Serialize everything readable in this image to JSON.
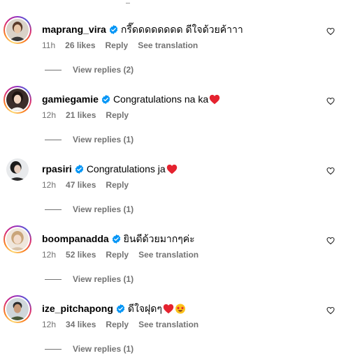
{
  "comments": [
    {
      "username": "maprang_vira",
      "text": "กรี๊ดดดดดดดด ดีใจด้วยค้าาา",
      "emojis": [],
      "time": "11h",
      "likes": "26 likes",
      "reply": "Reply",
      "translate": "See translation",
      "replies": "View replies (2)",
      "story_ring": true
    },
    {
      "username": "gamiegamie",
      "text": "Congratulations na ka",
      "emojis": [
        "red-heart"
      ],
      "time": "12h",
      "likes": "21 likes",
      "reply": "Reply",
      "translate": "",
      "replies": "View replies (1)",
      "story_ring": true
    },
    {
      "username": "rpasiri",
      "text": "Congratulations ja",
      "emojis": [
        "red-heart"
      ],
      "time": "12h",
      "likes": "47 likes",
      "reply": "Reply",
      "translate": "",
      "replies": "View replies (1)",
      "story_ring": false
    },
    {
      "username": "boompanadda",
      "text": "ยินดีด้วยมากๆค่ะ",
      "emojis": [],
      "time": "12h",
      "likes": "52 likes",
      "reply": "Reply",
      "translate": "See translation",
      "replies": "View replies (1)",
      "story_ring": true
    },
    {
      "username": "ize_pitchapong",
      "text": "ดีใจฝุดๆ",
      "emojis": [
        "red-heart",
        "star-struck-face"
      ],
      "time": "12h",
      "likes": "34 likes",
      "reply": "Reply",
      "translate": "See translation",
      "replies": "View replies (1)",
      "story_ring": true
    }
  ],
  "colors": {
    "verified": "#0095f6",
    "meta_text": "#737373",
    "emoji_heart": "#e5222f"
  }
}
